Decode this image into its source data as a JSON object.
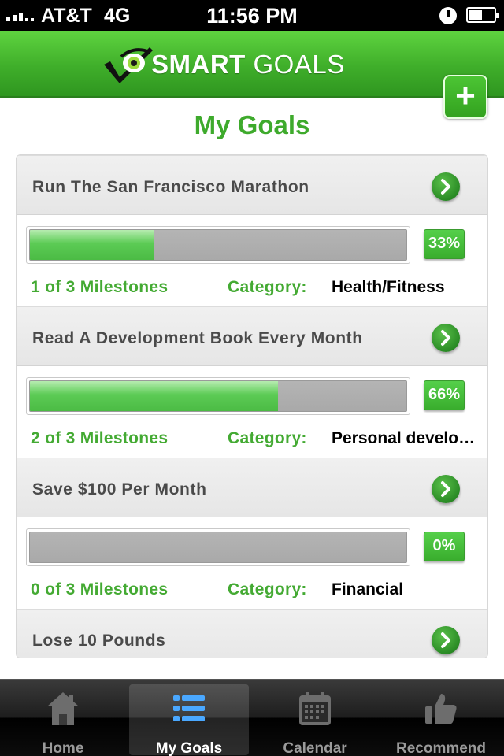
{
  "status_bar": {
    "carrier": "AT&T",
    "network": "4G",
    "time": "11:56 PM"
  },
  "header": {
    "logo_bold": "SMART",
    "logo_light": " GOALS",
    "add_label": "+"
  },
  "page": {
    "title": "My Goals"
  },
  "goals": [
    {
      "title": "Run The San Francisco Marathon",
      "progress": 0.33,
      "percent_label": "33%",
      "milestones": "1 of 3 Milestones",
      "category_label": "Category:",
      "category": "Health/Fitness"
    },
    {
      "title": "Read A Development Book Every Month",
      "progress": 0.66,
      "percent_label": "66%",
      "milestones": "2 of 3 Milestones",
      "category_label": "Category:",
      "category": "Personal develo…"
    },
    {
      "title": "Save $100 Per Month",
      "progress": 0,
      "percent_label": "0%",
      "milestones": "0 of 3 Milestones",
      "category_label": "Category:",
      "category": "Financial"
    },
    {
      "title": "Lose 10 Pounds"
    }
  ],
  "tabs": [
    {
      "label": "Home",
      "icon": "home-icon",
      "active": false
    },
    {
      "label": "My Goals",
      "icon": "list-icon",
      "active": true
    },
    {
      "label": "Calendar",
      "icon": "calendar-icon",
      "active": false
    },
    {
      "label": "Recommend",
      "icon": "thumbs-up-icon",
      "active": false
    }
  ],
  "colors": {
    "brand_green": "#3eaa2c",
    "header_green": "#4bc23a"
  }
}
